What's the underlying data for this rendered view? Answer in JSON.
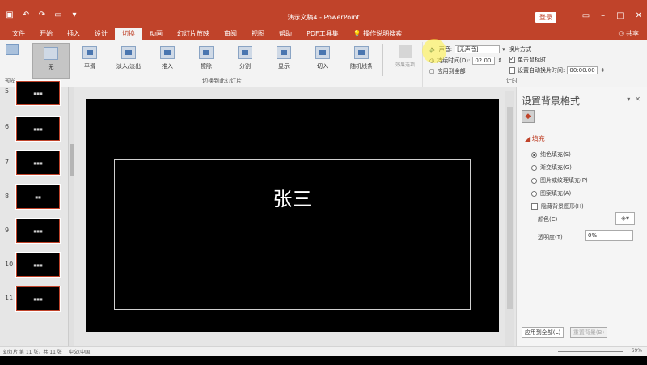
{
  "titlebar": {
    "title": "演示文稿4  -  PowerPoint",
    "login": "登录",
    "bg_color": "#c0432a"
  },
  "tabs": [
    {
      "label": "文件"
    },
    {
      "label": "开始"
    },
    {
      "label": "插入"
    },
    {
      "label": "设计"
    },
    {
      "label": "切换"
    },
    {
      "label": "动画"
    },
    {
      "label": "幻灯片放映"
    },
    {
      "label": "审阅"
    },
    {
      "label": "视图"
    },
    {
      "label": "帮助"
    },
    {
      "label": "PDF工具集"
    },
    {
      "label": "操作说明搜索"
    }
  ],
  "active_tab": "切换",
  "share": "共享",
  "ribbon": {
    "preview": "预览",
    "transitions": [
      {
        "label": "无"
      },
      {
        "label": "平滑"
      },
      {
        "label": "淡入/淡出"
      },
      {
        "label": "推入"
      },
      {
        "label": "擦除"
      },
      {
        "label": "分割"
      },
      {
        "label": "显示"
      },
      {
        "label": "切入"
      },
      {
        "label": "随机线条"
      }
    ],
    "effect_options": "效果选项",
    "group_label": "切换到此幻灯片",
    "timing": {
      "sound_label": "声音:",
      "sound_value": "[无声音]",
      "duration_label": "持续时间(D):",
      "duration_value": "02.00",
      "apply_all": "应用到全部",
      "advance_label": "换片方式",
      "on_click": "单击鼠标时",
      "after_label": "设置自动换片时间:",
      "after_value": "00:00.00",
      "group_label": "计时"
    }
  },
  "slides": [
    {
      "num": "5",
      "text": "■■■"
    },
    {
      "num": "6",
      "text": "■■■"
    },
    {
      "num": "7",
      "text": "■■■"
    },
    {
      "num": "8",
      "text": "■■"
    },
    {
      "num": "9",
      "text": "■■■"
    },
    {
      "num": "10",
      "text": "■■■"
    },
    {
      "num": "11",
      "text": "■■■"
    }
  ],
  "slide": {
    "title": "张三"
  },
  "format_pane": {
    "title": "设置背景格式",
    "fill_header": "填充",
    "options": [
      {
        "label": "纯色填充(S)",
        "selected": true
      },
      {
        "label": "渐变填充(G)",
        "selected": false
      },
      {
        "label": "图片或纹理填充(P)",
        "selected": false
      },
      {
        "label": "图案填充(A)",
        "selected": false
      },
      {
        "label": "隐藏背景图形(H)",
        "selected": false
      }
    ],
    "color_label": "颜色(C)",
    "transparency_label": "透明度(T)",
    "transparency_value": "0%",
    "apply_all": "应用到全部(L)",
    "reset": "重置背景(B)"
  },
  "status": {
    "slide_info": "幻灯片 第 11 张，共 11 张",
    "language": "中文(中国)",
    "zoom": "69%"
  }
}
